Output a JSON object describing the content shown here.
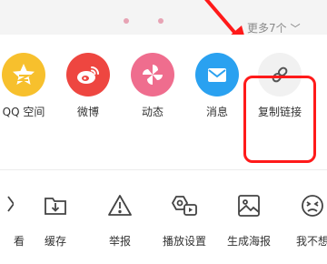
{
  "header": {
    "more_label": "更多7个"
  },
  "share_items": [
    {
      "label": "QQ 空间",
      "icon": "qzone-star-icon",
      "color": "#f7c02d"
    },
    {
      "label": "微博",
      "icon": "weibo-icon",
      "color": "#ee4640"
    },
    {
      "label": "动态",
      "icon": "pinwheel-icon",
      "color": "#ef6d8e"
    },
    {
      "label": "消息",
      "icon": "mail-icon",
      "color": "#2aa1f0"
    },
    {
      "label": "复制链接",
      "icon": "link-icon",
      "color": "#f1f1f1"
    }
  ],
  "tool_items": [
    {
      "label": "看",
      "icon": "watch-later-icon"
    },
    {
      "label": "缓存",
      "icon": "download-cache-icon"
    },
    {
      "label": "举报",
      "icon": "warning-icon"
    },
    {
      "label": "播放设置",
      "icon": "play-settings-icon"
    },
    {
      "label": "生成海报",
      "icon": "image-poster-icon"
    },
    {
      "label": "我不想",
      "icon": "dislike-face-icon"
    }
  ],
  "colors": {
    "highlight": "#ff1a1a",
    "arrow": "#ff1a1a"
  }
}
